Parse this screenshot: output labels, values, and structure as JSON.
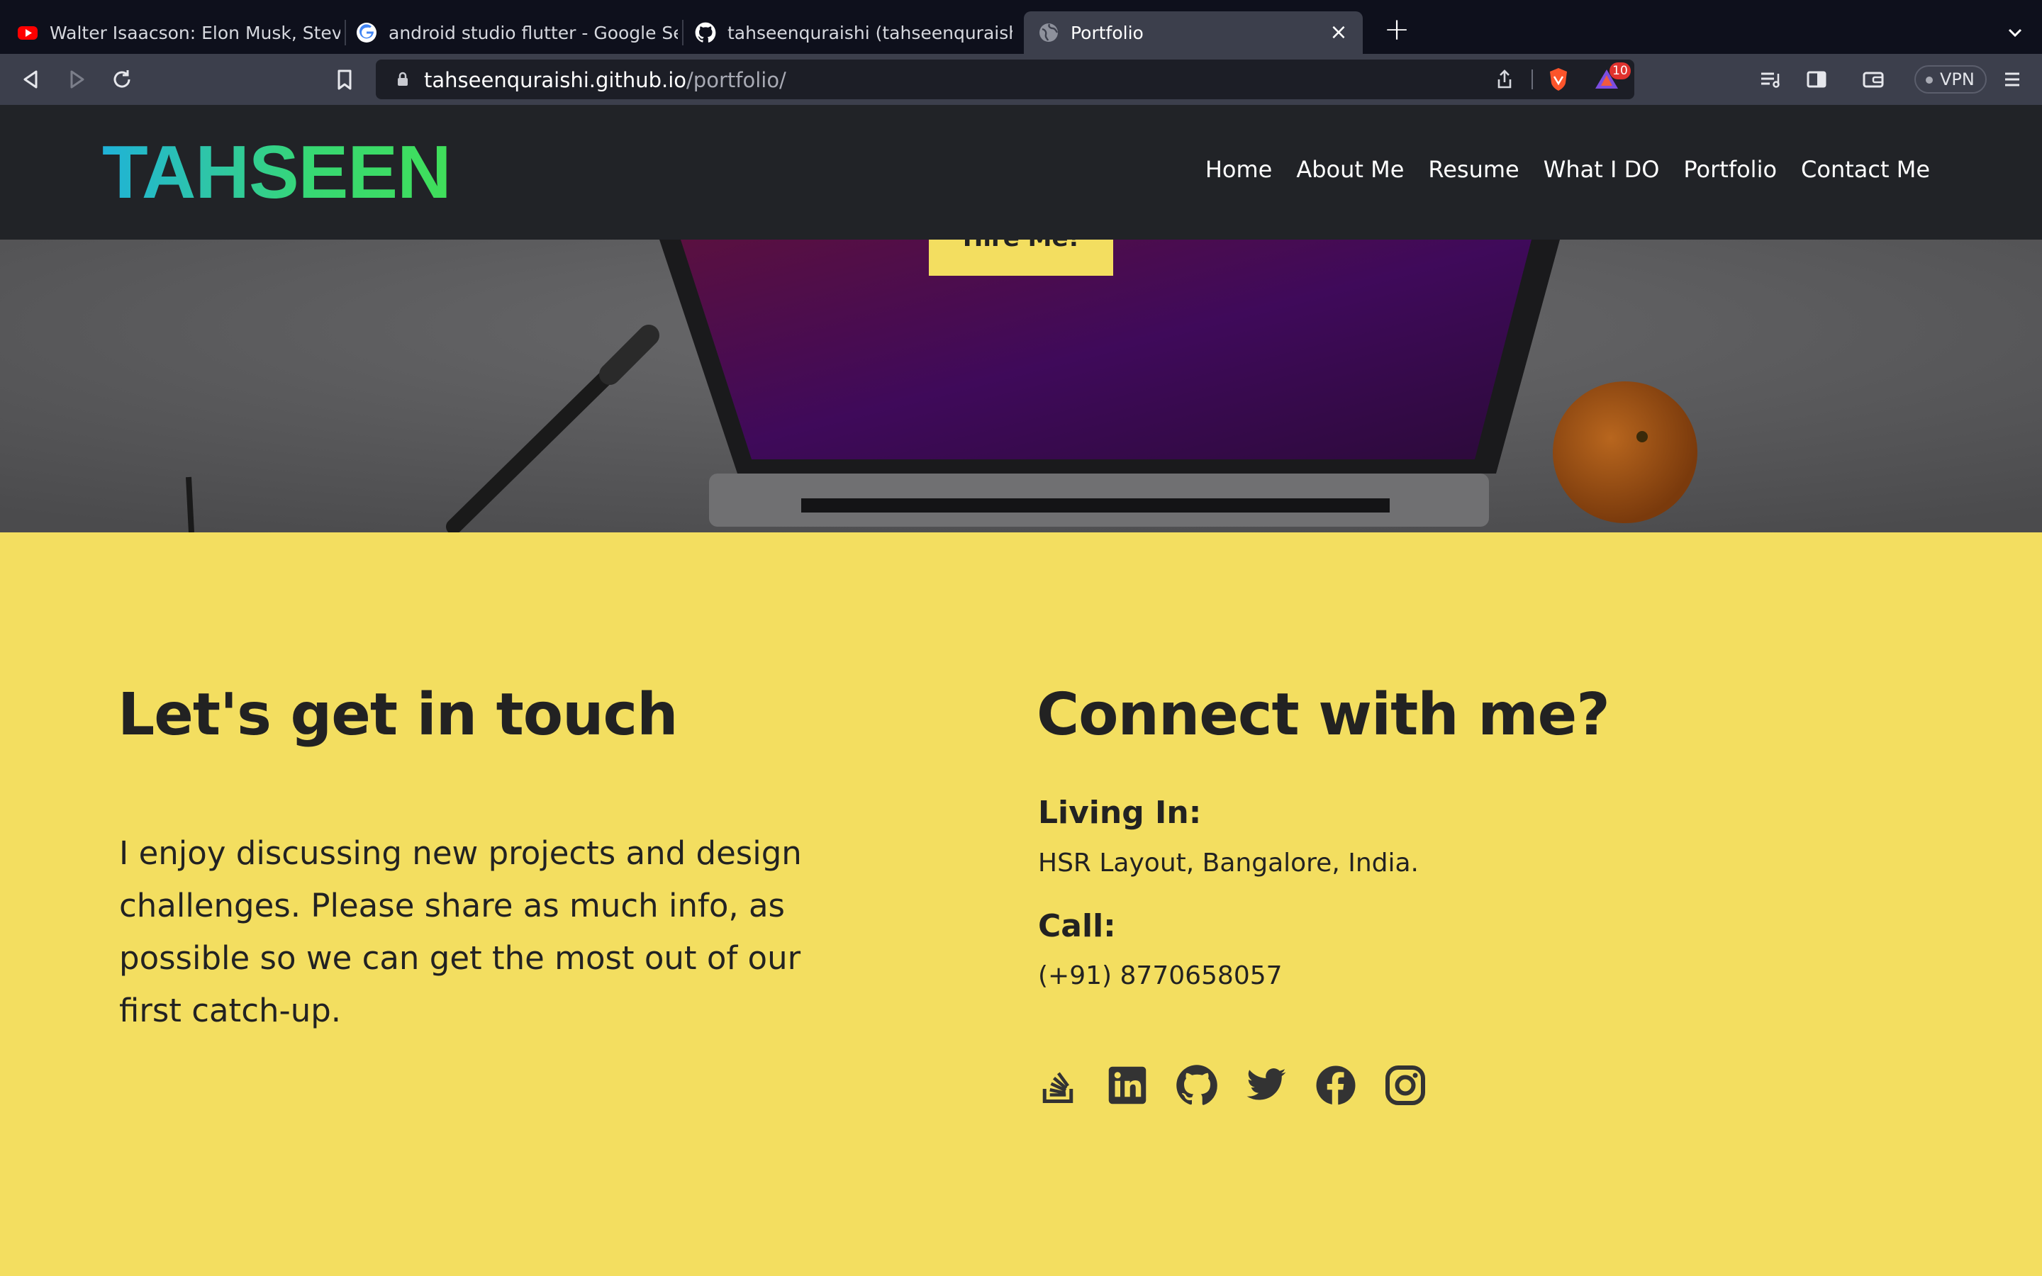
{
  "browser": {
    "tabs": [
      {
        "title": "Walter Isaacson: Elon Musk, Steve J",
        "icon": "youtube-icon"
      },
      {
        "title": "android studio flutter - Google Sear",
        "icon": "google-icon"
      },
      {
        "title": "tahseenquraishi (tahseenquraishi) /",
        "icon": "github-icon"
      },
      {
        "title": "Portfolio",
        "icon": "globe-icon",
        "active": true
      }
    ],
    "url_host": "tahseenquraishi.github.io",
    "url_path": "/portfolio/",
    "shields_badge": "10",
    "vpn_label": "VPN"
  },
  "site": {
    "logo": "TAHSEEN",
    "nav": [
      "Home",
      "About Me",
      "Resume",
      "What I DO",
      "Portfolio",
      "Contact Me"
    ],
    "hire_button": "Hire Me!"
  },
  "contact": {
    "left_heading": "Let's get in touch",
    "intro": "I enjoy discussing new projects and design challenges. Please share as much info, as possible so we can get the most out of our first catch-up.",
    "right_heading": "Connect with me?",
    "living_label": "Living In:",
    "living_value": "HSR Layout, Bangalore, India.",
    "call_label": "Call:",
    "call_value": "(+91) 8770658057",
    "socials": [
      "stackoverflow-icon",
      "linkedin-icon",
      "github-icon",
      "twitter-icon",
      "facebook-icon",
      "instagram-icon"
    ]
  },
  "colors": {
    "accent_yellow": "#f3de60",
    "nav_bg": "#212327",
    "text_dark": "#222222"
  }
}
